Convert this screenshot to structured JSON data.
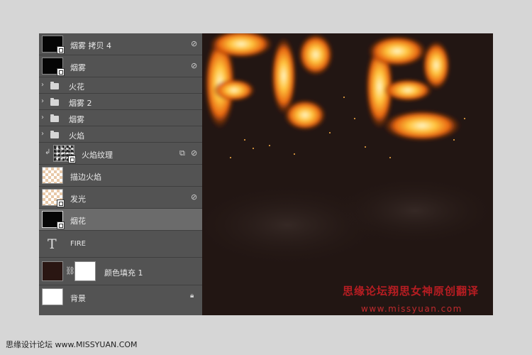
{
  "layers_panel": {
    "layers": [
      {
        "name": "烟雾 拷贝 4"
      },
      {
        "name": "烟雾"
      },
      {
        "name": "火花"
      },
      {
        "name": "烟雾 2"
      },
      {
        "name": "烟雾"
      },
      {
        "name": "火焰"
      },
      {
        "name": "火焰纹理"
      },
      {
        "name": "描边火焰"
      },
      {
        "name": "发光"
      },
      {
        "name": "烟花"
      },
      {
        "name": "FIRE"
      },
      {
        "name": "颜色填充 1"
      },
      {
        "name": "背景"
      }
    ],
    "type_layer_icon": "T"
  },
  "canvas": {
    "watermark_title": "思缘论坛翔思女神原创翻译",
    "watermark_url": "www.missyuan.com",
    "background_color": "#221613"
  },
  "credit": "思缘设计论坛 www.MISSYUAN.COM",
  "colors": {
    "panel_bg": "#535353",
    "selected_row": "#6b6b6b",
    "watermark_red": "#b71d22"
  }
}
